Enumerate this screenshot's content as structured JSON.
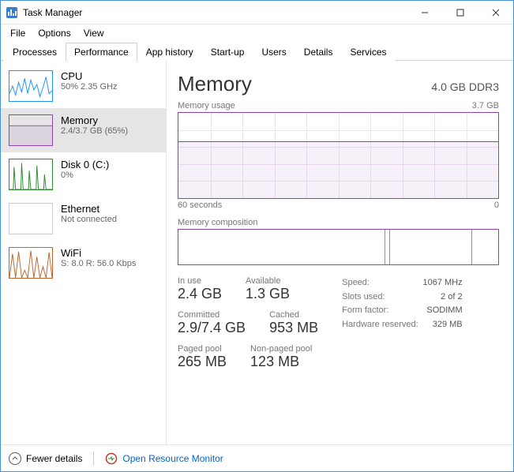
{
  "window": {
    "title": "Task Manager"
  },
  "menu": {
    "items": [
      "File",
      "Options",
      "View"
    ]
  },
  "tabs": {
    "items": [
      "Processes",
      "Performance",
      "App history",
      "Start-up",
      "Users",
      "Details",
      "Services"
    ],
    "active": 1
  },
  "sidebar": {
    "items": [
      {
        "name": "CPU",
        "sub": "50%  2.35 GHz",
        "color": "#1e90ff"
      },
      {
        "name": "Memory",
        "sub": "2.4/3.7 GB (65%)",
        "color": "#8e44ad"
      },
      {
        "name": "Disk 0 (C:)",
        "sub": "0%",
        "color": "#2e8b2e"
      },
      {
        "name": "Ethernet",
        "sub": "Not connected",
        "color": "#bbbbbb"
      },
      {
        "name": "WiFi",
        "sub": "S: 8.0 R: 56.0 Kbps",
        "color": "#c0632c"
      }
    ],
    "selected": 1
  },
  "main": {
    "title": "Memory",
    "capacity": "4.0 GB DDR3",
    "usage_label": "Memory usage",
    "usage_max": "3.7 GB",
    "time_left": "60 seconds",
    "time_right": "0",
    "composition_label": "Memory composition",
    "stats": {
      "in_use": {
        "label": "In use",
        "value": "2.4 GB"
      },
      "available": {
        "label": "Available",
        "value": "1.3 GB"
      },
      "committed": {
        "label": "Committed",
        "value": "2.9/7.4 GB"
      },
      "cached": {
        "label": "Cached",
        "value": "953 MB"
      },
      "paged": {
        "label": "Paged pool",
        "value": "265 MB"
      },
      "nonpaged": {
        "label": "Non-paged pool",
        "value": "123 MB"
      }
    },
    "right_stats": {
      "speed": {
        "label": "Speed:",
        "value": "1067 MHz"
      },
      "slots": {
        "label": "Slots used:",
        "value": "2 of 2"
      },
      "form": {
        "label": "Form factor:",
        "value": "SODIMM"
      },
      "reserved": {
        "label": "Hardware reserved:",
        "value": "329 MB"
      }
    }
  },
  "footer": {
    "fewer": "Fewer details",
    "resmon": "Open Resource Monitor"
  },
  "chart_data": {
    "type": "line",
    "title": "Memory usage",
    "xlabel": "seconds",
    "ylabel": "GB",
    "x_range": [
      60,
      0
    ],
    "ylim": [
      0,
      3.7
    ],
    "series": [
      {
        "name": "Memory in use",
        "x": [
          60,
          50,
          40,
          30,
          20,
          10,
          0
        ],
        "values": [
          2.45,
          2.4,
          2.4,
          2.42,
          2.4,
          2.4,
          2.4
        ],
        "color": "#8e44ad"
      }
    ],
    "composition": {
      "type": "stacked-bar",
      "total_gb": 3.7,
      "segments": [
        {
          "name": "In use",
          "value_gb": 2.4
        },
        {
          "name": "Modified",
          "value_gb": 0.05
        },
        {
          "name": "Standby",
          "value_gb": 0.95
        },
        {
          "name": "Free",
          "value_gb": 0.3
        }
      ]
    }
  }
}
